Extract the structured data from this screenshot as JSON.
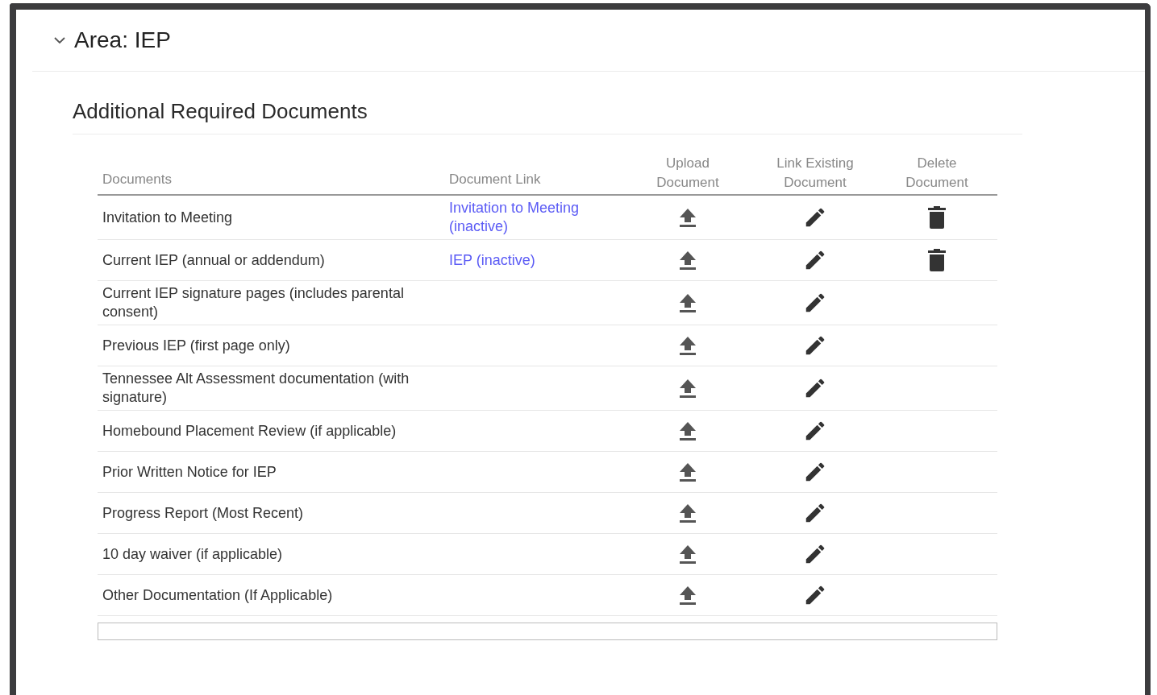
{
  "area": {
    "title": "Area: IEP",
    "expanded": true
  },
  "section": {
    "title": "Additional Required Documents"
  },
  "table": {
    "columns": [
      {
        "label": "Documents",
        "kind": "text"
      },
      {
        "label": "Document Link",
        "kind": "link"
      },
      {
        "label": "Upload Document",
        "kind": "upload"
      },
      {
        "label": "Link Existing Document",
        "kind": "edit"
      },
      {
        "label": "Delete Document",
        "kind": "delete"
      }
    ],
    "rows": [
      {
        "document": "Invitation to Meeting",
        "link": "Invitation to Meeting (inactive)",
        "deletable": true
      },
      {
        "document": "Current IEP (annual or addendum)",
        "link": "IEP (inactive)",
        "deletable": true
      },
      {
        "document": "Current IEP signature pages (includes parental consent)",
        "deletable": false
      },
      {
        "document": "Previous IEP (first page only)",
        "deletable": false
      },
      {
        "document": "Tennessee Alt Assessment documentation (with signature)",
        "deletable": false
      },
      {
        "document": "Homebound Placement Review (if applicable)",
        "deletable": false
      },
      {
        "document": "Prior Written Notice for IEP",
        "deletable": false
      },
      {
        "document": "Progress Report (Most Recent)",
        "deletable": false
      },
      {
        "document": "10 day waiver (if applicable)",
        "deletable": false
      },
      {
        "document": "Other Documentation (If Applicable)",
        "deletable": false
      }
    ]
  }
}
